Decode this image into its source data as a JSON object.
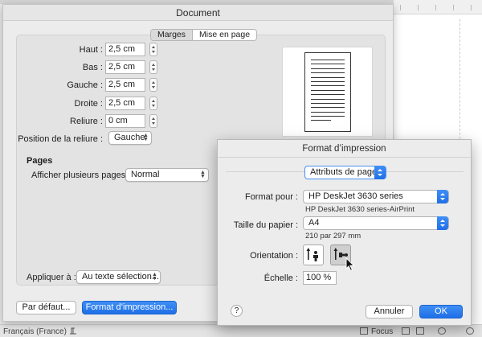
{
  "document_dialog": {
    "title": "Document",
    "tabs": [
      {
        "label": "Marges",
        "selected": true
      },
      {
        "label": "Mise en page",
        "selected": false
      }
    ],
    "margins": [
      {
        "label": "Haut :",
        "value": "2,5 cm"
      },
      {
        "label": "Bas :",
        "value": "2,5 cm"
      },
      {
        "label": "Gauche :",
        "value": "2,5 cm"
      },
      {
        "label": "Droite :",
        "value": "2,5 cm"
      },
      {
        "label": "Reliure :",
        "value": "0 cm"
      }
    ],
    "binding_position": {
      "label": "Position de la reliure :",
      "value": "Gauche"
    },
    "pages": {
      "title": "Pages",
      "multiple_pages_label": "Afficher plusieurs pages :",
      "multiple_pages_value": "Normal"
    },
    "apply_to": {
      "label": "Appliquer à :",
      "value": "Au texte sélection..."
    },
    "default_button": "Par défaut...",
    "print_format_button": "Format d’impression..."
  },
  "print_dialog": {
    "title": "Format d’impression",
    "attributes_popup": "Attributs de page",
    "format_for_label": "Format pour :",
    "format_for_value": "HP DeskJet 3630 series",
    "format_for_sub": "HP DeskJet 3630 series-AirPrint",
    "paper_size_label": "Taille du papier :",
    "paper_size_value": "A4",
    "paper_size_sub": "210 par 297 mm",
    "orientation_label": "Orientation :",
    "orientation_options": [
      {
        "name": "portrait",
        "selected": false
      },
      {
        "name": "landscape",
        "selected": true
      }
    ],
    "scale_label": "Échelle :",
    "scale_value": "100 %",
    "help": "?",
    "cancel_button": "Annuler",
    "ok_button": "OK"
  },
  "statusbar": {
    "language": "Français (France)",
    "focus": "Focus"
  }
}
